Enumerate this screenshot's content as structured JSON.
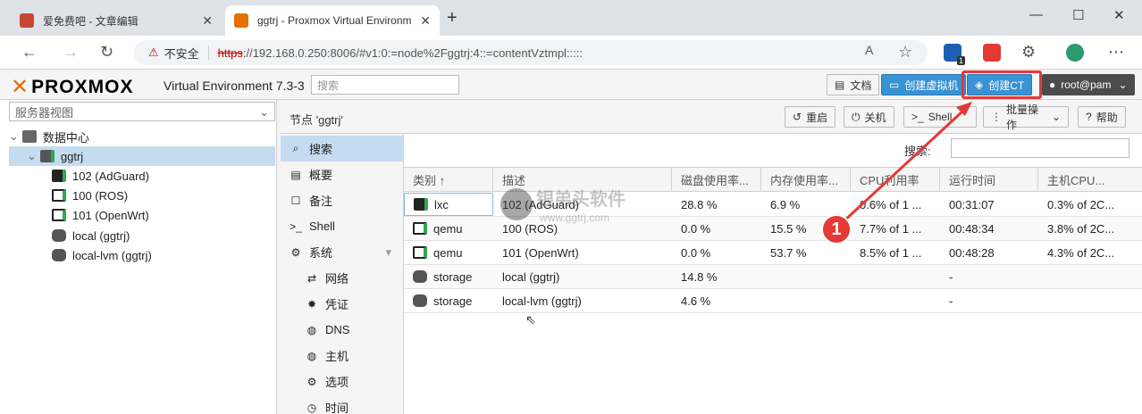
{
  "browser": {
    "tabs": [
      {
        "title": "爱免费吧 - 文章编辑",
        "active": false
      },
      {
        "title": "ggtrj - Proxmox Virtual Environm",
        "active": true
      }
    ],
    "new_tab": "+",
    "window_controls": [
      "—",
      "☐",
      "✕"
    ],
    "address": {
      "warning": "不安全",
      "scheme": "https",
      "rest": "://192.168.0.250:8006/#v1:0:=node%2Fggtrj:4::=contentVztmpl:::::"
    },
    "extension_badge": "1"
  },
  "header": {
    "logo": "PROXMOX",
    "version": "Virtual Environment 7.3-3",
    "search_placeholder": "搜索",
    "buttons": {
      "docs": "文档",
      "create_vm": "创建虚拟机",
      "create_ct": "创建CT",
      "user": "root@pam"
    }
  },
  "tree": {
    "view": "服务器视图",
    "datacenter": "数据中心",
    "node": "ggtrj",
    "items": [
      "102 (AdGuard)",
      "100 (ROS)",
      "101 (OpenWrt)",
      "local (ggtrj)",
      "local-lvm (ggtrj)"
    ]
  },
  "toolbar": {
    "breadcrumb": "节点 'ggtrj'",
    "reboot": "重启",
    "shutdown": "关机",
    "shell": "Shell",
    "bulk": "批量操作",
    "help": "帮助"
  },
  "nav": {
    "items": [
      "搜索",
      "概要",
      "备注",
      "Shell",
      "系统"
    ],
    "subitems": [
      "网络",
      "凭证",
      "DNS",
      "主机",
      "选项",
      "时间"
    ]
  },
  "grid": {
    "search_label": "搜索:",
    "columns": [
      "类别 ↑",
      "描述",
      "磁盘使用率...",
      "内存使用率...",
      "CPU利用率",
      "运行时间",
      "主机CPU..."
    ],
    "rows": [
      [
        "lxc",
        "102 (AdGuard)",
        "28.8 %",
        "6.9 %",
        "0.6% of 1 ...",
        "00:31:07",
        "0.3% of 2C..."
      ],
      [
        "qemu",
        "100 (ROS)",
        "0.0 %",
        "15.5 %",
        "7.7% of 1 ...",
        "00:48:34",
        "3.8% of 2C..."
      ],
      [
        "qemu",
        "101 (OpenWrt)",
        "0.0 %",
        "53.7 %",
        "8.5% of 1 ...",
        "00:48:28",
        "4.3% of 2C..."
      ],
      [
        "storage",
        "local (ggtrj)",
        "14.8 %",
        "",
        "",
        "-",
        ""
      ],
      [
        "storage",
        "local-lvm (ggtrj)",
        "4.6 %",
        "",
        "",
        "-",
        ""
      ]
    ]
  },
  "annotation": {
    "step": "1"
  },
  "watermark": {
    "text": "银弟头软件",
    "url": "www.ggtrj.com"
  }
}
